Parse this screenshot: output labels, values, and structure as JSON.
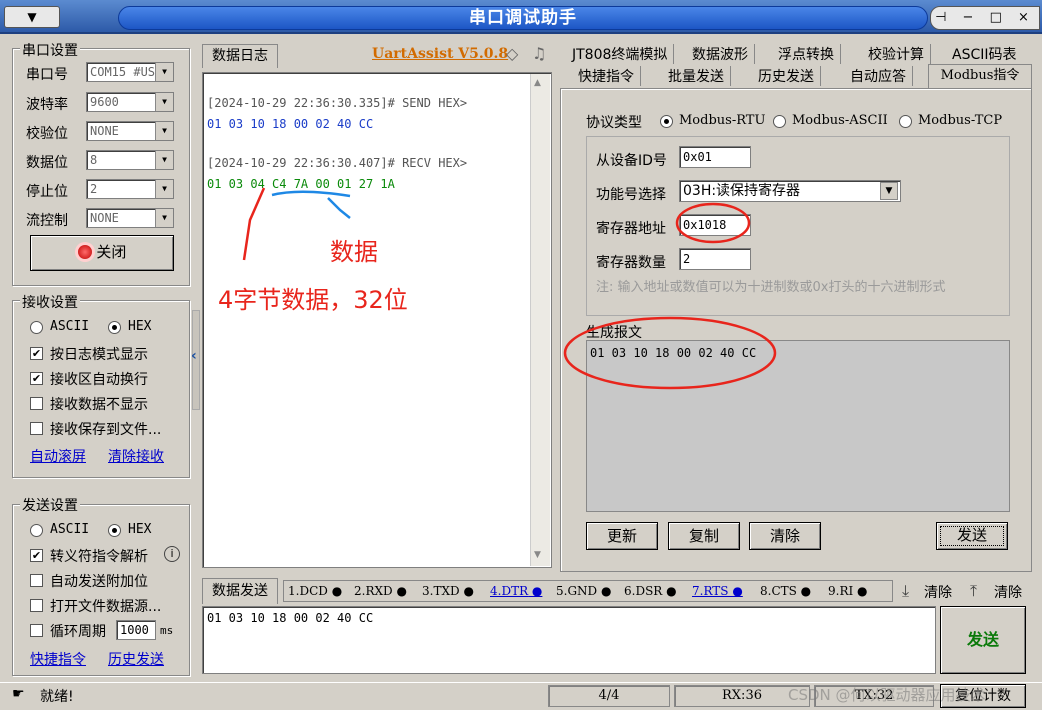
{
  "window": {
    "title": "串口调试助手",
    "menu_label": "▼",
    "controls": "⊣ − □ ×"
  },
  "serial": {
    "group_title": "串口设置",
    "port_label": "串口号",
    "port_value": "COM15 #US",
    "baud_label": "波特率",
    "baud_value": "9600",
    "parity_label": "校验位",
    "parity_value": "NONE",
    "databits_label": "数据位",
    "databits_value": "8",
    "stopbits_label": "停止位",
    "stopbits_value": "2",
    "flow_label": "流控制",
    "flow_value": "NONE",
    "close_button": "关闭"
  },
  "receive": {
    "group_title": "接收设置",
    "ascii": "ASCII",
    "hex": "HEX",
    "opt_log": "按日志模式显示",
    "opt_wrap": "接收区自动换行",
    "opt_hide": "接收数据不显示",
    "opt_save": "接收保存到文件...",
    "link_scroll": "自动滚屏",
    "link_clear": "清除接收"
  },
  "send": {
    "group_title": "发送设置",
    "ascii": "ASCII",
    "hex": "HEX",
    "opt_escape": "转义符指令解析",
    "opt_check": "自动发送附加位",
    "opt_file": "打开文件数据源...",
    "opt_cycle": "循环周期",
    "cycle_value": "1000",
    "cycle_unit": "ms",
    "link_quick": "快捷指令",
    "link_history": "历史发送"
  },
  "log": {
    "tab_label": "数据日志",
    "brand": "UartAssist V5.0.8",
    "entries": [
      {
        "header": "[2024-10-29 22:36:30.335]# SEND HEX>",
        "data": "01 03 10 18 00 02 40 CC"
      },
      {
        "header": "[2024-10-29 22:36:30.407]# RECV HEX>",
        "data": "01 03 04 C4 7A 00 01 27 1A"
      }
    ]
  },
  "annotations": {
    "data": "数据",
    "bytes": "4字节数据，32位"
  },
  "right_tabs": {
    "row1": [
      "JT808终端模拟",
      "数据波形",
      "浮点转换",
      "校验计算",
      "ASCII码表"
    ],
    "row2": [
      "快捷指令",
      "批量发送",
      "历史发送",
      "自动应答",
      "Modbus指令"
    ]
  },
  "modbus": {
    "protocol_label": "协议类型",
    "protocols": [
      "Modbus-RTU",
      "Modbus-ASCII",
      "Modbus-TCP"
    ],
    "slave_label": "从设备ID号",
    "slave_value": "0x01",
    "func_label": "功能号选择",
    "func_value": "03H:读保持寄存器",
    "addr_label": "寄存器地址",
    "addr_value": "0x1018",
    "count_label": "寄存器数量",
    "count_value": "2",
    "note": "注: 输入地址或数值可以为十进制数或0x打头的十六进制形式",
    "gen_label": "生成报文",
    "gen_value": "01 03 10 18 00 02 40 CC",
    "btn_update": "更新",
    "btn_copy": "复制",
    "btn_clear": "清除",
    "btn_send": "发送"
  },
  "sendbar": {
    "tab_label": "数据发送",
    "pins": [
      "1.DCD",
      "2.RXD",
      "3.TXD",
      "4.DTR",
      "5.GND",
      "6.DSR",
      "7.RTS",
      "8.CTS",
      "9.RI"
    ],
    "clear1": "清除",
    "clear2": "清除",
    "input_value": "01 03 10 18 00 02 40 CC",
    "send_button": "发送"
  },
  "status": {
    "ready": "就绪!",
    "count": "4/4",
    "rx": "RX:36",
    "tx": "TX:32",
    "reset": "复位计数",
    "watermark": "CSDN @何以驱动器应用技术"
  }
}
